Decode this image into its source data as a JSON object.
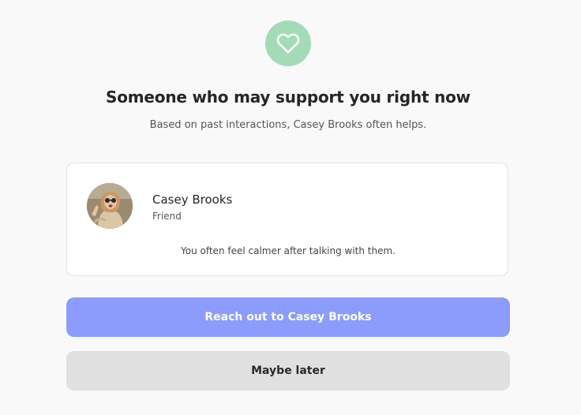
{
  "header": {
    "icon": "heart-icon",
    "icon_bg_color": "#a3dbb7",
    "title": "Someone who may support you right now",
    "subtitle": "Based on past interactions, Casey Brooks often helps."
  },
  "contact": {
    "name": "Casey Brooks",
    "relation": "Friend",
    "note": "You often feel calmer after talking with them."
  },
  "actions": {
    "primary_label": "Reach out to Casey Brooks",
    "primary_color": "#8b9cfd",
    "secondary_label": "Maybe later",
    "secondary_color": "#e0e0e0"
  }
}
